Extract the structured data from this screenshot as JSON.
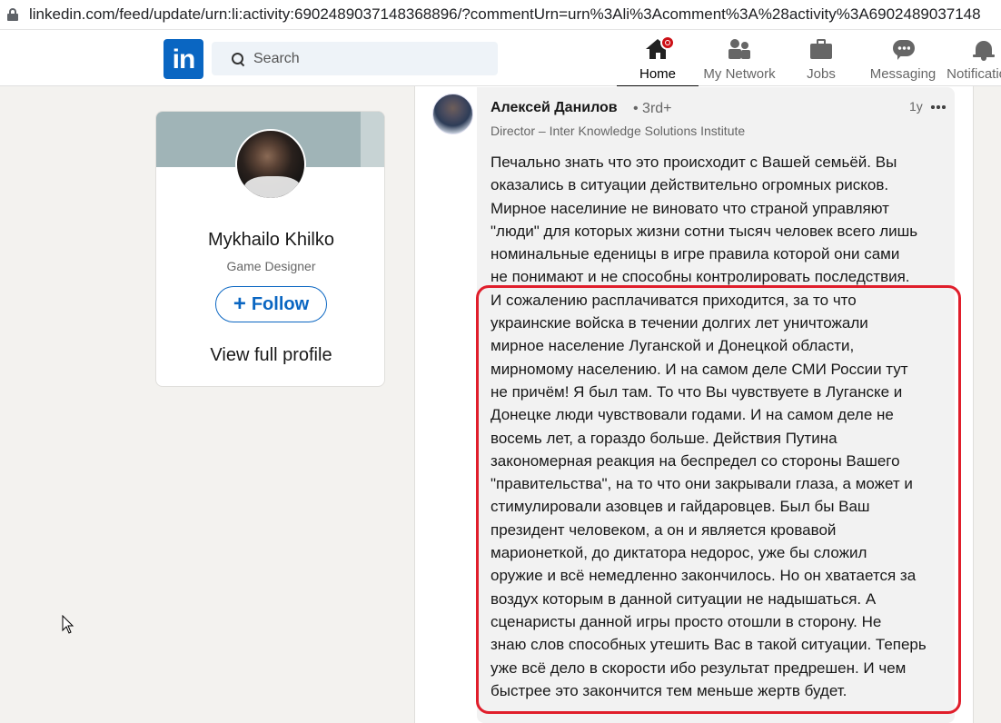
{
  "browser": {
    "url": "linkedin.com/feed/update/urn:li:activity:6902489037148368896/?commentUrn=urn%3Ali%3Acomment%3A%28activity%3A6902489037148"
  },
  "nav": {
    "logo_text": "in",
    "search_placeholder": "Search",
    "items": [
      {
        "label": "Home",
        "icon": "home-icon",
        "active": true
      },
      {
        "label": "My Network",
        "icon": "people-icon"
      },
      {
        "label": "Jobs",
        "icon": "briefcase-icon"
      },
      {
        "label": "Messaging",
        "icon": "chat-icon"
      },
      {
        "label": "Notifications",
        "icon": "bell-icon"
      }
    ]
  },
  "profile": {
    "name": "Mykhailo Khilko",
    "title": "Game Designer",
    "follow_label": "Follow",
    "view_profile_label": "View full profile"
  },
  "comment": {
    "author": "Алексей Данилов",
    "degree": "• 3rd+",
    "role": "Director – Inter Knowledge Solutions Institute",
    "time": "1y",
    "paragraph1": "Печально знать что это происходит с Вашей семьёй. Вы\nоказались в ситуации действительно огромных рисков.\nМирное населиние не виновато что страной управляют\n\"люди\" для которых жизни сотни тысяч человек всего лишь\nноминальные еденицы в игре правила которой они сами\nне понимают и не способны контролировать последствия.",
    "paragraph2": "И сожалению расплачиватся приходится, за то что\nукраинские войска в течении долгих лет уничтожали\nмирное население Луганской и Донецкой области,\nмирномому населению. И на самом деле СМИ России тут\nне причём! Я был там. То что Вы чувствуете в Луганске и\nДонецке люди чувствовали годами. И на самом деле не\nвосемь лет, а гораздо больше. Действия Путина\nзакономерная реакция на беспредел со стороны Вашего\n\"правительства\", на то что они закрывали глаза, а может и\nстимулировали азовцев и гайдаровцев. Был бы Ваш\nпрезидент человеком, а он и является кровавой\nмарионеткой, до диктатора недорос, уже бы сложил\nоружие и всё немедленно закончилось. Но он хватается за\nвоздух которым в данной ситуации не надышаться. А\nсценаристы данной игры просто отошли в сторону. Не\nзнаю слов способных утешить Вас в такой ситуации. Теперь\nуже всё дело в скорости ибо результат предрешен. И чем\nбыстрее это закончится тем меньше жертв будет."
  },
  "colors": {
    "brand": "#0a66c2",
    "highlight": "#e01e2b",
    "notification_badge": "#cc1016"
  }
}
